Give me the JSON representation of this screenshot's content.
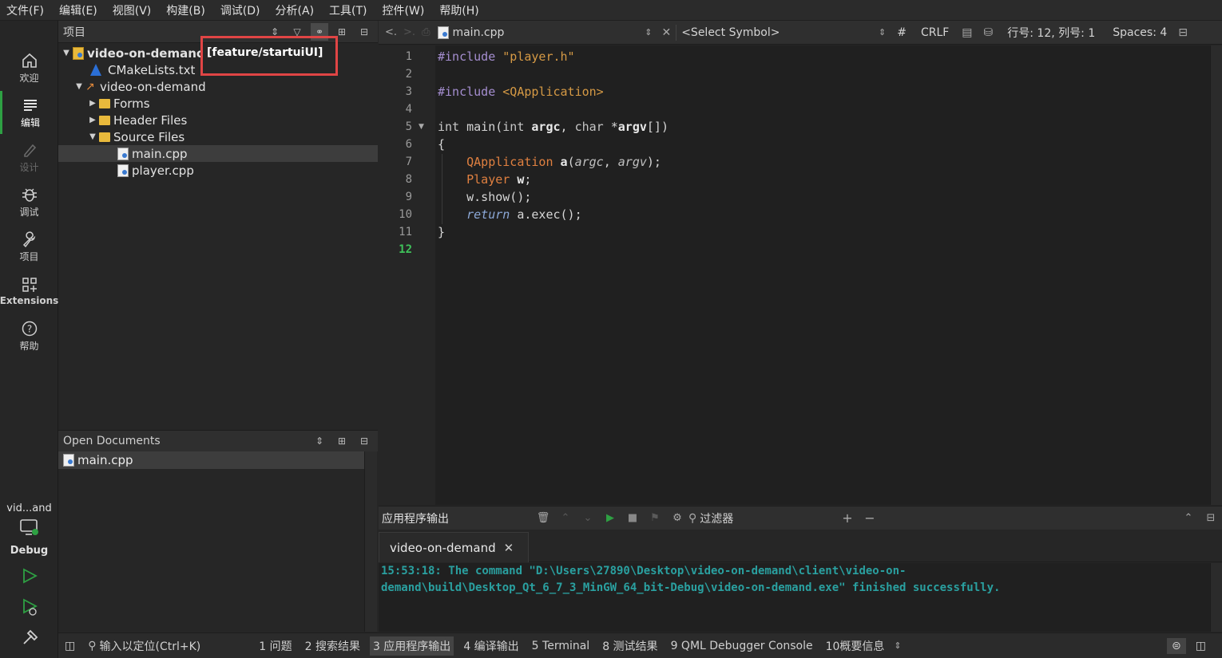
{
  "menu": [
    "文件(F)",
    "编辑(E)",
    "视图(V)",
    "构建(B)",
    "调试(D)",
    "分析(A)",
    "工具(T)",
    "控件(W)",
    "帮助(H)"
  ],
  "modes": [
    {
      "label": "欢迎",
      "icon": "home-icon"
    },
    {
      "label": "编辑",
      "icon": "edit-icon"
    },
    {
      "label": "设计",
      "icon": "design-icon"
    },
    {
      "label": "调试",
      "icon": "debug-icon"
    },
    {
      "label": "项目",
      "icon": "wrench-icon"
    },
    {
      "label": "Extensions",
      "icon": "extensions-icon"
    },
    {
      "label": "帮助",
      "icon": "help-icon"
    }
  ],
  "kit": {
    "project_short": "vid...and",
    "build_config": "Debug"
  },
  "project_panel": {
    "title": "项目",
    "tree": [
      {
        "label": "video-on-demanc",
        "level": 0,
        "expanded": true,
        "type": "project-root",
        "bold": true
      },
      {
        "label": "CMakeLists.txt",
        "level": 1,
        "type": "cmake"
      },
      {
        "label": "video-on-demand",
        "level": 1,
        "expanded": true,
        "type": "target"
      },
      {
        "label": "Forms",
        "level": 2,
        "expanded": false,
        "type": "folder"
      },
      {
        "label": "Header Files",
        "level": 2,
        "expanded": false,
        "type": "folder"
      },
      {
        "label": "Source Files",
        "level": 2,
        "expanded": true,
        "type": "folder"
      },
      {
        "label": "main.cpp",
        "level": 3,
        "type": "file",
        "selected": true
      },
      {
        "label": "player.cpp",
        "level": 3,
        "type": "file"
      }
    ],
    "branch": "[feature/startuiUI]"
  },
  "open_documents": {
    "title": "Open Documents",
    "items": [
      "main.cpp"
    ]
  },
  "editor_toolbar": {
    "file": "main.cpp",
    "symbol": "<Select Symbol>",
    "hash": "#",
    "line_ending": "CRLF",
    "position": "行号: 12, 列号: 1",
    "indent": "Spaces: 4"
  },
  "code": {
    "current_line": 12,
    "lines": [
      "#include \"player.h\"",
      "",
      "#include <QApplication>",
      "",
      "int main(int argc, char *argv[])",
      "{",
      "    QApplication a(argc, argv);",
      "    Player w;",
      "    w.show();",
      "    return a.exec();",
      "}",
      ""
    ]
  },
  "output": {
    "title": "应用程序输出",
    "filter_label": "过滤器",
    "tab": "video-on-demand",
    "lines": [
      "15:53:18: The command \"D:\\Users\\27890\\Desktop\\video-on-demand\\client\\video-on-",
      "demand\\build\\Desktop_Qt_6_7_3_MinGW_64_bit-Debug\\video-on-demand.exe\" finished successfully."
    ]
  },
  "statusbar": {
    "locator_placeholder": "输入以定位(Ctrl+K)",
    "tabs": [
      "1 问题",
      "2 搜索结果",
      "3 应用程序输出",
      "4 编译输出",
      "5 Terminal",
      "8 测试结果",
      "9 QML Debugger Console",
      "10概要信息"
    ],
    "active_tab": 2
  },
  "colors": {
    "accent": "#2ea043",
    "highlight_box": "#e04545",
    "output_text": "#2aa0a0"
  }
}
